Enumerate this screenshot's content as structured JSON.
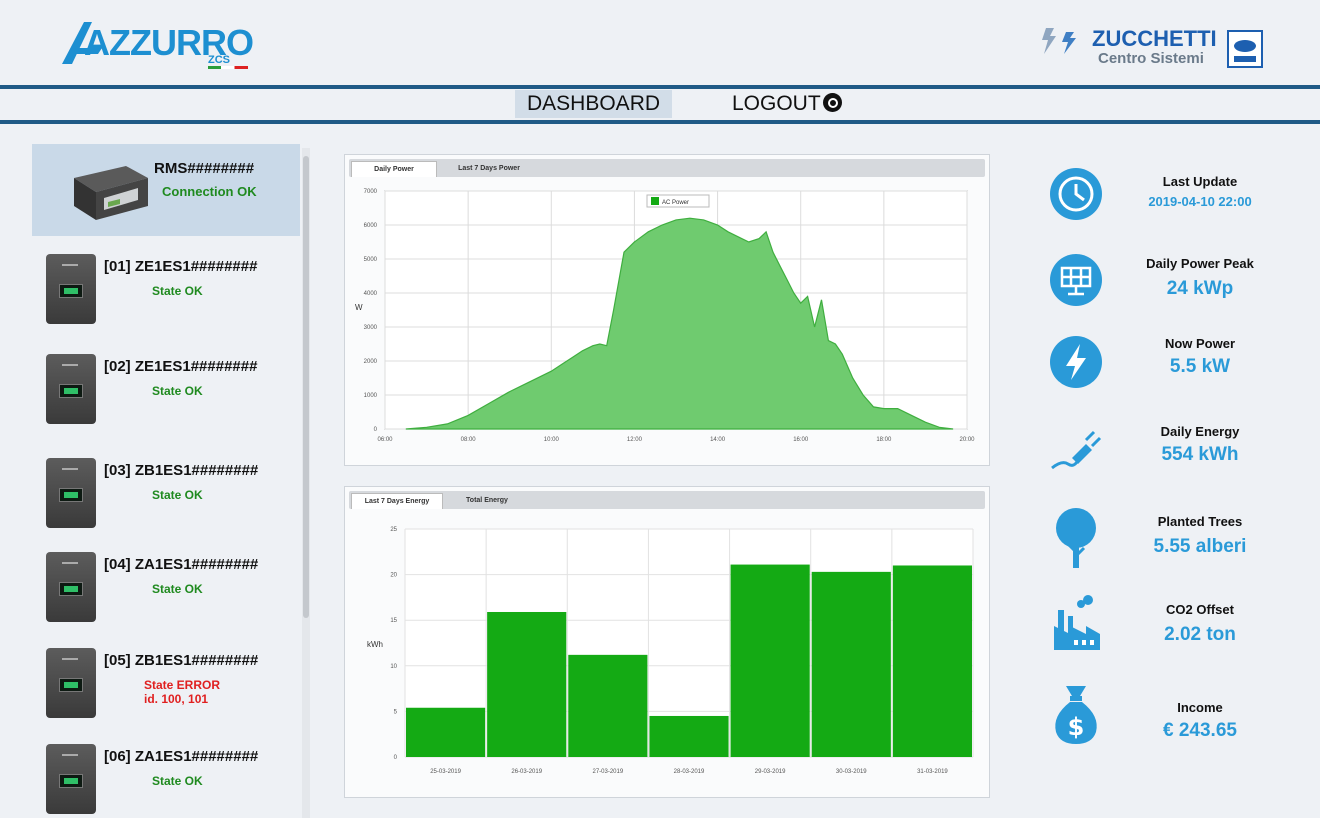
{
  "header": {
    "logo_left_text": "AZZURRO",
    "logo_left_sub": "ZCS",
    "logo_right_main": "ZUCCHETTI",
    "logo_right_sub": "Centro Sistemi"
  },
  "nav": {
    "dashboard": "DASHBOARD",
    "logout": "LOGOUT"
  },
  "devices": {
    "rms": {
      "name": "RMS########",
      "status": "Connection OK"
    },
    "inverters": [
      {
        "name": "[01] ZE1ES1########",
        "status": "State OK",
        "detail": ""
      },
      {
        "name": "[02] ZE1ES1########",
        "status": "State OK",
        "detail": ""
      },
      {
        "name": "[03] ZB1ES1########",
        "status": "State OK",
        "detail": ""
      },
      {
        "name": "[04] ZA1ES1########",
        "status": "State OK",
        "detail": ""
      },
      {
        "name": "[05] ZB1ES1########",
        "status": "State ERROR",
        "detail": "id. 100, 101"
      },
      {
        "name": "[06] ZA1ES1########",
        "status": "State OK",
        "detail": ""
      }
    ]
  },
  "power_chart": {
    "tabs": [
      "Daily Power",
      "Last 7 Days Power"
    ]
  },
  "energy_chart": {
    "tabs": [
      "Last 7 Days Energy",
      "Total Energy"
    ]
  },
  "chart_data": [
    {
      "type": "area",
      "ylabel": "W",
      "legend": [
        "AC Power"
      ],
      "legend_position": "top-center",
      "grid": true,
      "xlim": [
        "06:00",
        "20:00"
      ],
      "ylim": [
        0,
        7000
      ],
      "x_ticks": [
        "06:00",
        "08:00",
        "10:00",
        "12:00",
        "14:00",
        "16:00",
        "18:00",
        "20:00"
      ],
      "y_ticks": [
        0,
        1000,
        2000,
        3000,
        4000,
        5000,
        6000,
        7000
      ],
      "series": [
        {
          "name": "AC Power",
          "color": "#6fcb6f",
          "x": [
            "06:30",
            "07:00",
            "07:30",
            "08:00",
            "08:30",
            "09:00",
            "09:30",
            "10:00",
            "10:15",
            "10:30",
            "10:45",
            "11:00",
            "11:10",
            "11:20",
            "11:30",
            "11:45",
            "12:00",
            "12:20",
            "12:40",
            "13:00",
            "13:20",
            "13:40",
            "14:00",
            "14:15",
            "14:30",
            "14:45",
            "15:00",
            "15:10",
            "15:20",
            "15:30",
            "15:40",
            "15:50",
            "16:00",
            "16:10",
            "16:20",
            "16:30",
            "16:40",
            "16:50",
            "17:00",
            "17:15",
            "17:30",
            "17:45",
            "18:00",
            "18:20",
            "18:40",
            "19:00",
            "19:20",
            "19:40"
          ],
          "values": [
            0,
            50,
            150,
            400,
            750,
            1100,
            1400,
            1700,
            1900,
            2100,
            2300,
            2450,
            2500,
            2450,
            3500,
            5200,
            5500,
            5800,
            6000,
            6150,
            6200,
            6150,
            6000,
            5800,
            5650,
            5500,
            5600,
            5800,
            5200,
            4800,
            4400,
            4000,
            3700,
            3900,
            3000,
            3800,
            2600,
            2500,
            2200,
            1500,
            1000,
            650,
            600,
            600,
            400,
            200,
            50,
            0
          ]
        }
      ]
    },
    {
      "type": "bar",
      "ylabel": "kWh",
      "grid": true,
      "ylim": [
        0,
        25
      ],
      "y_ticks": [
        0,
        5,
        10,
        15,
        20,
        25
      ],
      "categories": [
        "25-03-2019",
        "26-03-2019",
        "27-03-2019",
        "28-03-2019",
        "29-03-2019",
        "30-03-2019",
        "31-03-2019"
      ],
      "values": [
        5.4,
        15.9,
        11.2,
        4.5,
        21.1,
        20.3,
        21.0
      ],
      "color": "#14aa14"
    }
  ],
  "stats": [
    {
      "label": "Last Update",
      "value": "2019-04-10  22:00",
      "icon": "clock-icon"
    },
    {
      "label": "Daily Power Peak",
      "value": "24 kWp",
      "icon": "solar-panel-icon"
    },
    {
      "label": "Now Power",
      "value": "5.5 kW",
      "icon": "lightning-icon"
    },
    {
      "label": "Daily Energy",
      "value": "554 kWh",
      "icon": "plug-icon"
    },
    {
      "label": "Planted Trees",
      "value": "5.55 alberi",
      "icon": "tree-icon"
    },
    {
      "label": "CO2 Offset",
      "value": "2.02 ton",
      "icon": "factory-icon"
    },
    {
      "label": "Income",
      "value": "€ 243.65",
      "icon": "money-bag-icon"
    }
  ],
  "colors": {
    "accent": "#2a9ad8",
    "nav_line": "#1f5a86",
    "ok": "#1f8a1f",
    "error": "#e02020"
  }
}
